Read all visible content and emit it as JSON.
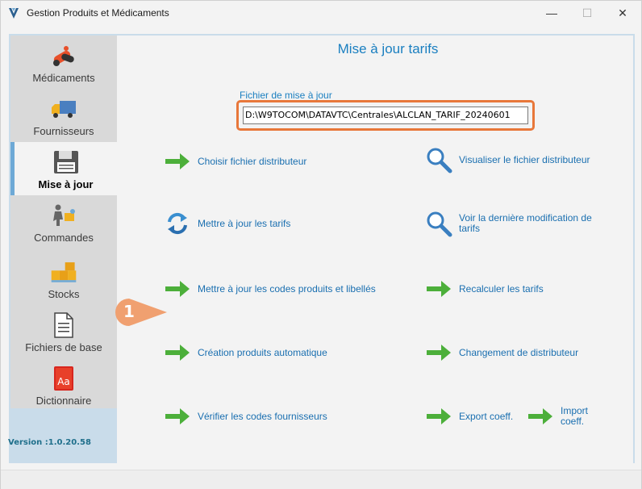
{
  "window": {
    "title": "Gestion Produits et Médicaments",
    "minimize_glyph": "—",
    "maximize_glyph": "☐",
    "close_glyph": "✕"
  },
  "sidebar": {
    "items": [
      {
        "label": "Médicaments",
        "icon": "pills-icon"
      },
      {
        "label": "Fournisseurs",
        "icon": "truck-icon"
      },
      {
        "label": "Mise à jour",
        "icon": "floppy-disk-icon",
        "active": true
      },
      {
        "label": "Commandes",
        "icon": "delivery-person-icon"
      },
      {
        "label": "Stocks",
        "icon": "boxes-icon"
      },
      {
        "label": "Fichiers de base",
        "icon": "document-icon"
      },
      {
        "label": "Dictionnaire",
        "icon": "dictionary-icon"
      }
    ]
  },
  "version": "Version :1.0.20.58",
  "main": {
    "title": "Mise à jour tarifs",
    "file_label": "Fichier de mise à jour",
    "file_value": "D:\\W9TOCOM\\DATAVTC\\Centrales\\ALCLAN_TARIF_20240601",
    "actions_left": [
      {
        "label": "Choisir fichier distributeur",
        "icon": "green-arrow-icon"
      },
      {
        "label": "Mettre à jour les tarifs",
        "icon": "refresh-icon"
      },
      {
        "label": "Mettre à jour les codes produits et libellés",
        "icon": "green-arrow-icon"
      },
      {
        "label": "Création produits automatique",
        "icon": "green-arrow-icon"
      },
      {
        "label": "Vérifier les codes fournisseurs",
        "icon": "green-arrow-icon"
      }
    ],
    "actions_right": [
      {
        "label": "Visualiser le fichier distributeur",
        "icon": "magnifier-icon"
      },
      {
        "label": "Voir la dernière modification de tarifs",
        "icon": "magnifier-icon"
      },
      {
        "label": "Recalculer les tarifs",
        "icon": "green-arrow-icon"
      },
      {
        "label": "Changement de distributeur",
        "icon": "green-arrow-icon"
      },
      {
        "label": "Export coeff.",
        "icon": "green-arrow-icon"
      },
      {
        "label": "Import coeff.",
        "icon": "green-arrow-icon"
      }
    ],
    "callout_number": "1"
  },
  "colors": {
    "accent": "#1a7fc0",
    "highlight_border": "#e8773a",
    "arrow_green": "#4caf3a",
    "badge_orange": "#f0a070"
  }
}
